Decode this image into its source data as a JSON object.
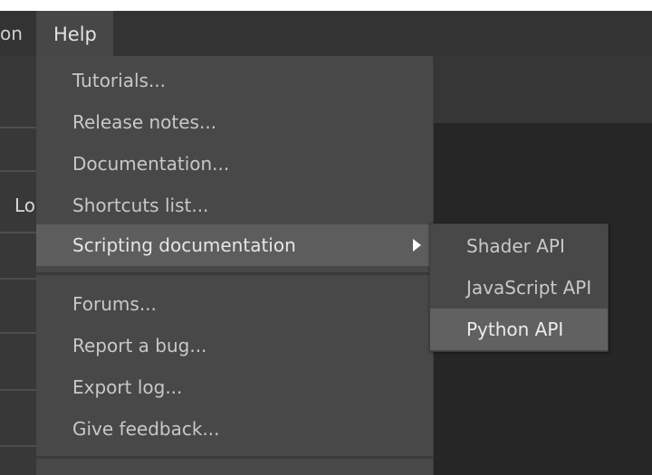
{
  "menubar": {
    "partial_item": "on",
    "help_label": "Help"
  },
  "background": {
    "partial_label": "Lo"
  },
  "help_menu": {
    "items": [
      {
        "label": "Tutorials..."
      },
      {
        "label": "Release notes..."
      },
      {
        "label": "Documentation..."
      },
      {
        "label": "Shortcuts list..."
      },
      {
        "label": "Scripting documentation",
        "has_submenu": true,
        "highlighted": true
      },
      {
        "label": "Forums..."
      },
      {
        "label": "Report a bug..."
      },
      {
        "label": "Export log..."
      },
      {
        "label": "Give feedback..."
      }
    ]
  },
  "scripting_submenu": {
    "items": [
      {
        "label": "Shader API"
      },
      {
        "label": "JavaScript API"
      },
      {
        "label": "Python API",
        "highlighted": true
      }
    ]
  },
  "colors": {
    "menu_bg": "#484848",
    "highlight": "#5d5d5d",
    "menubar_bg": "#333333",
    "text": "#c8c8c8"
  }
}
